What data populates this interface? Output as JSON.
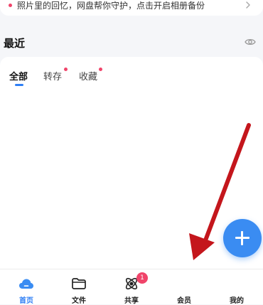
{
  "tip_banner": {
    "text": "照片里的回忆，网盘帮你守护，点击开启相册备份"
  },
  "recent": {
    "title": "最近",
    "tabs": [
      {
        "label": "全部",
        "active": true,
        "has_dot": false
      },
      {
        "label": "转存",
        "active": false,
        "has_dot": true
      },
      {
        "label": "收藏",
        "active": false,
        "has_dot": true
      }
    ]
  },
  "bottom_nav": {
    "items": [
      {
        "label": "首页",
        "active": true
      },
      {
        "label": "文件",
        "active": false
      },
      {
        "label": "共享",
        "active": false,
        "badge": "1"
      },
      {
        "label": "会员",
        "active": false
      },
      {
        "label": "我的",
        "active": false
      }
    ]
  },
  "colors": {
    "accent": "#2f7ff5",
    "badge": "#f0446a",
    "arrow": "#c4161c"
  },
  "icons": {
    "tip_arrow": "chevron-right-icon",
    "visibility": "eye-icon",
    "fab": "plus-icon"
  }
}
